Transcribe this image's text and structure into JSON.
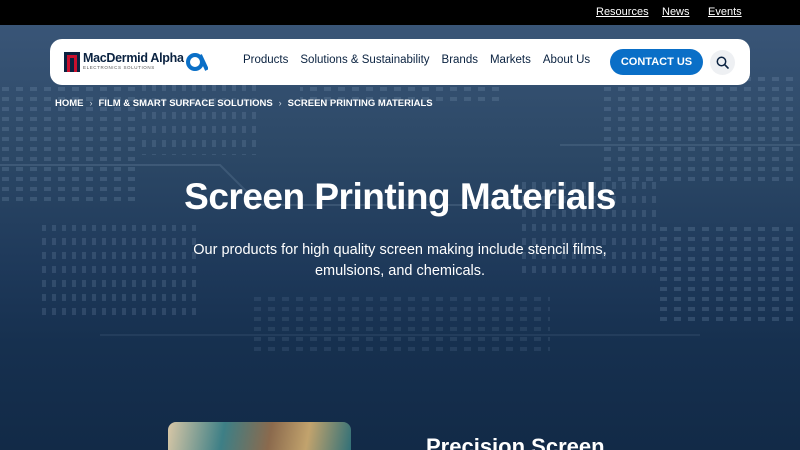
{
  "utility_nav": [
    "Resources",
    "News",
    "Events"
  ],
  "brand": {
    "name": "MacDermid Alpha",
    "tagline": "ELECTRONICS SOLUTIONS"
  },
  "main_nav": [
    "Products",
    "Solutions & Sustainability",
    "Brands",
    "Markets",
    "About Us"
  ],
  "header": {
    "contact_label": "CONTACT US"
  },
  "breadcrumb": [
    "HOME",
    "FILM & SMART SURFACE SOLUTIONS",
    "SCREEN PRINTING MATERIALS"
  ],
  "hero": {
    "title": "Screen Printing Materials",
    "intro": "Our products for high quality screen making include stencil films, emulsions, and chemicals."
  },
  "section": {
    "title": "Precision Screen"
  },
  "colors": {
    "accent": "#0a6fc7",
    "brand_red": "#c8102e",
    "navy": "#0a2240"
  },
  "icons": {
    "search": "search-icon",
    "chevron": "chevron-right-icon"
  }
}
